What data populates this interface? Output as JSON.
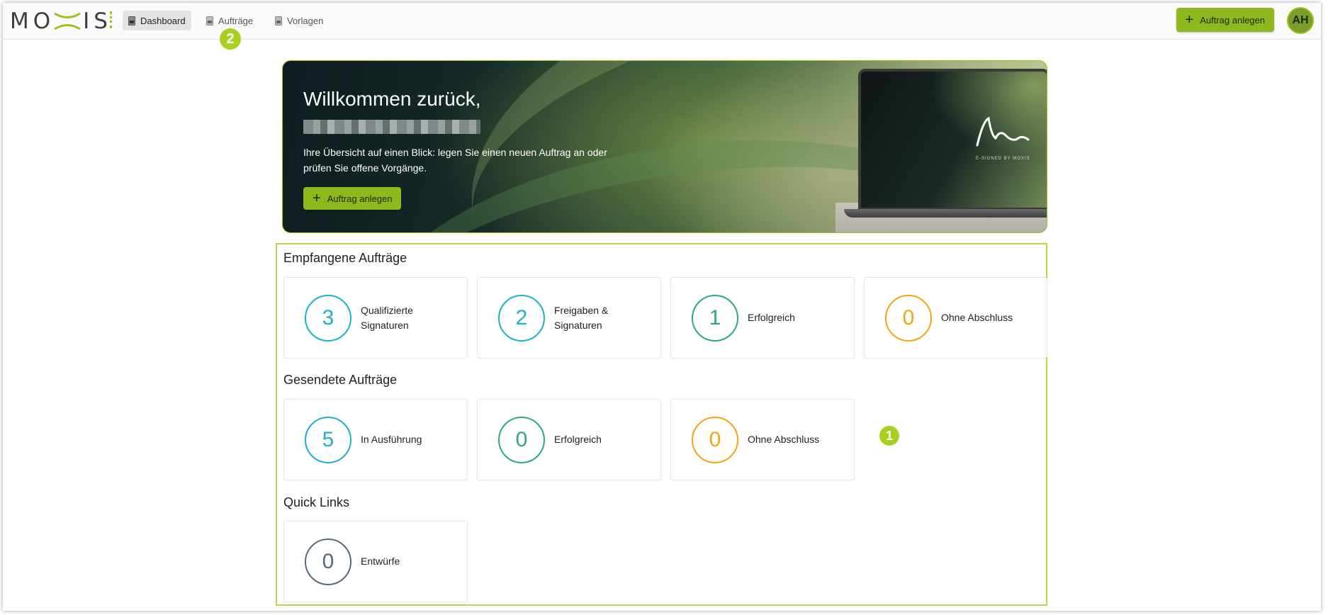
{
  "header": {
    "logo_text": "MO",
    "logo_text_end": "IS",
    "nav": [
      {
        "label": "Dashboard"
      },
      {
        "label": "Aufträge"
      },
      {
        "label": "Vorlagen"
      }
    ],
    "create_button_label": "Auftrag anlegen",
    "avatar_initials": "AH",
    "marker_2": "2"
  },
  "hero": {
    "title": "Willkommen zurück,",
    "text": "Ihre Übersicht auf einen Blick: legen Sie einen neuen Auftrag an oder prüfen Sie offene Vorgänge.",
    "button_label": "Auftrag anlegen",
    "laptop_brand": "E-SIGNED BY MOXIS"
  },
  "received": {
    "title": "Empfangene Aufträge",
    "cards": [
      {
        "count": "3",
        "label": "Qualifizierte Signaturen",
        "color": "#1fb1c9"
      },
      {
        "count": "2",
        "label": "Freigaben & Signaturen",
        "color": "#1fb1c9"
      },
      {
        "count": "1",
        "label": "Erfolgreich",
        "color": "#2ea884"
      },
      {
        "count": "0",
        "label": "Ohne Abschluss",
        "color": "#f2a516"
      }
    ]
  },
  "sent": {
    "title": "Gesendete Aufträge",
    "cards": [
      {
        "count": "5",
        "label": "In Ausführung",
        "color": "#1fb1c9"
      },
      {
        "count": "0",
        "label": "Erfolgreich",
        "color": "#2ea884"
      },
      {
        "count": "0",
        "label": "Ohne Abschluss",
        "color": "#f2a516"
      }
    ]
  },
  "quick": {
    "title": "Quick Links",
    "cards": [
      {
        "count": "0",
        "label": "Entwürfe",
        "color": "#5a6a7a"
      }
    ]
  },
  "marker_1": "1"
}
